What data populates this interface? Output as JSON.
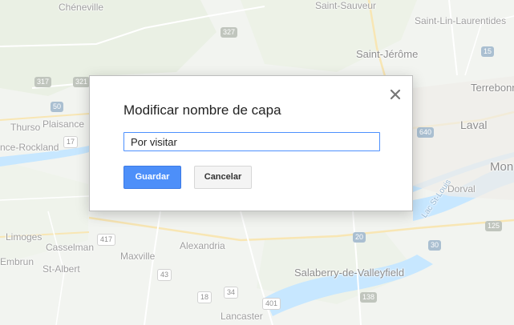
{
  "map": {
    "labels": {
      "cheneville": "Chéneville",
      "saint_sauveur": "Saint-Sauveur",
      "saint_lin": "Saint-Lin-Laurentides",
      "saint_jerome": "Saint-Jérôme",
      "terrebonne": "Terrebonn",
      "laval": "Laval",
      "mont": "Mon",
      "thurso": "Thurso",
      "plaisance": "Plaisance",
      "rockland": "nce-Rockland",
      "dorval": "Dorval",
      "limoges": "Limoges",
      "casselman": "Casselman",
      "alexandria": "Alexandria",
      "embrun": "Embrun",
      "maxville": "Maxville",
      "st_albert": "St-Albert",
      "salaberry": "Salaberry-de-Valleyfield",
      "lancaster": "Lancaster",
      "lac_st_louis": "Lac St-Louis"
    },
    "shields": {
      "s327": "327",
      "s317": "317",
      "s321": "321",
      "s50": "50",
      "s17": "17",
      "s640": "640",
      "s417": "417",
      "s43": "43",
      "s20": "20",
      "s30": "30",
      "s18": "18",
      "s34": "34",
      "s401": "401",
      "s138": "138",
      "s15": "15",
      "s125": "125"
    }
  },
  "dialog": {
    "title": "Modificar nombre de capa",
    "input_value": "Por visitar",
    "save_label": "Guardar",
    "cancel_label": "Cancelar"
  },
  "colors": {
    "primary_button": "#4d8ff9",
    "input_border": "#4d90fe"
  }
}
